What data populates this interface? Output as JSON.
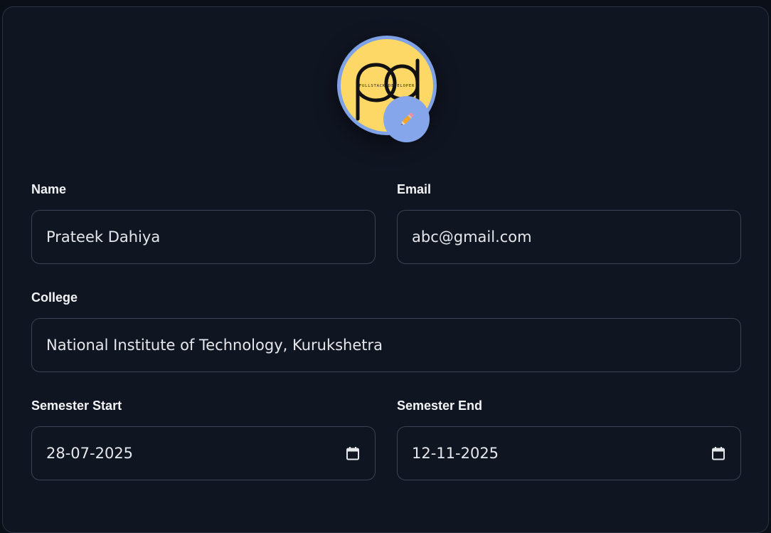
{
  "avatar": {
    "logo_text": "pd",
    "logo_subtext": "FULLSTACK DEVELOPER",
    "edit_icon": "pencil-icon"
  },
  "form": {
    "name": {
      "label": "Name",
      "value": "Prateek Dahiya"
    },
    "email": {
      "label": "Email",
      "value": "abc@gmail.com"
    },
    "college": {
      "label": "College",
      "value": "National Institute of Technology, Kurukshetra"
    },
    "semester_start": {
      "label": "Semester Start",
      "value": "28-07-2025",
      "icon": "calendar-icon"
    },
    "semester_end": {
      "label": "Semester End",
      "value": "12-11-2025",
      "icon": "calendar-icon"
    }
  },
  "colors": {
    "background": "#101522",
    "border": "#3a4254",
    "avatar_ring": "#7fa1e6",
    "avatar_fill": "#fdd866",
    "edit_button": "#86a6ec"
  }
}
